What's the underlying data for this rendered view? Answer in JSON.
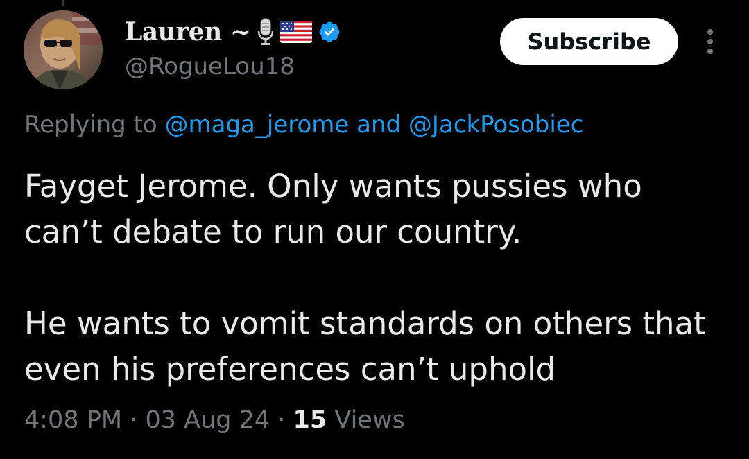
{
  "tweet": {
    "author": {
      "display_name": "Lauren ~",
      "emojis": [
        "microphone-emoji",
        "us-flag-emoji"
      ],
      "verified_icon": "verified-badge-icon",
      "handle": "@RogueLou18",
      "avatar": "profile-avatar"
    },
    "subscribe_label": "Subscribe",
    "more_icon": "more-vertical-icon",
    "reply": {
      "prefix": "Replying to",
      "mention_1": "@maga_jerome",
      "joiner": "and",
      "mention_2": "@JackPosobiec"
    },
    "paragraphs": [
      "Fayget Jerome. Only wants pussies who can’t debate to run our country.",
      "He wants to vomit standards on others that even his preferences can’t uphold"
    ],
    "time": "4:08 PM",
    "separator": "·",
    "date": "03 Aug 24",
    "views_count": "15",
    "views_label": "Views"
  },
  "colors": {
    "background": "#000000",
    "text": "#e7e9ea",
    "secondary": "#71767b",
    "link": "#1d9bf0",
    "verified": "#1d9bf0",
    "button_bg": "#ffffff",
    "button_text": "#0f1419"
  }
}
